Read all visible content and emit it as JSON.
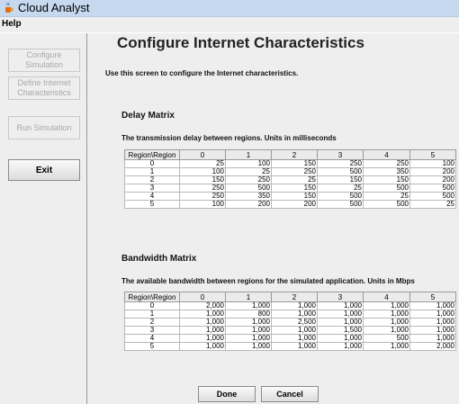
{
  "window": {
    "title": "Cloud Analyst"
  },
  "menu": {
    "help": "Help"
  },
  "sidebar": {
    "configure": "Configure Simulation",
    "define": "Define Internet Characteristics",
    "run": "Run Simulation",
    "exit": "Exit"
  },
  "page": {
    "title": "Configure Internet Characteristics",
    "description": "Use this screen to configure the Internet characteristics."
  },
  "delay": {
    "title": "Delay Matrix",
    "description": "The transmission delay between regions. Units in milliseconds",
    "headers": [
      "Region\\Region",
      "0",
      "1",
      "2",
      "3",
      "4",
      "5"
    ],
    "rows": [
      [
        "0",
        "25",
        "100",
        "150",
        "250",
        "250",
        "100"
      ],
      [
        "1",
        "100",
        "25",
        "250",
        "500",
        "350",
        "200"
      ],
      [
        "2",
        "150",
        "250",
        "25",
        "150",
        "150",
        "200"
      ],
      [
        "3",
        "250",
        "500",
        "150",
        "25",
        "500",
        "500"
      ],
      [
        "4",
        "250",
        "350",
        "150",
        "500",
        "25",
        "500"
      ],
      [
        "5",
        "100",
        "200",
        "200",
        "500",
        "500",
        "25"
      ]
    ]
  },
  "bandwidth": {
    "title": "Bandwidth Matrix",
    "description": "The available bandwidth between regions for the simulated application. Units in Mbps",
    "headers": [
      "Region\\Region",
      "0",
      "1",
      "2",
      "3",
      "4",
      "5"
    ],
    "rows": [
      [
        "0",
        "2,000",
        "1,000",
        "1,000",
        "1,000",
        "1,000",
        "1,000"
      ],
      [
        "1",
        "1,000",
        "800",
        "1,000",
        "1,000",
        "1,000",
        "1,000"
      ],
      [
        "2",
        "1,000",
        "1,000",
        "2,500",
        "1,000",
        "1,000",
        "1,000"
      ],
      [
        "3",
        "1,000",
        "1,000",
        "1,000",
        "1,500",
        "1,000",
        "1,000"
      ],
      [
        "4",
        "1,000",
        "1,000",
        "1,000",
        "1,000",
        "500",
        "1,000"
      ],
      [
        "5",
        "1,000",
        "1,000",
        "1,000",
        "1,000",
        "1,000",
        "2,000"
      ]
    ]
  },
  "actions": {
    "done": "Done",
    "cancel": "Cancel"
  }
}
